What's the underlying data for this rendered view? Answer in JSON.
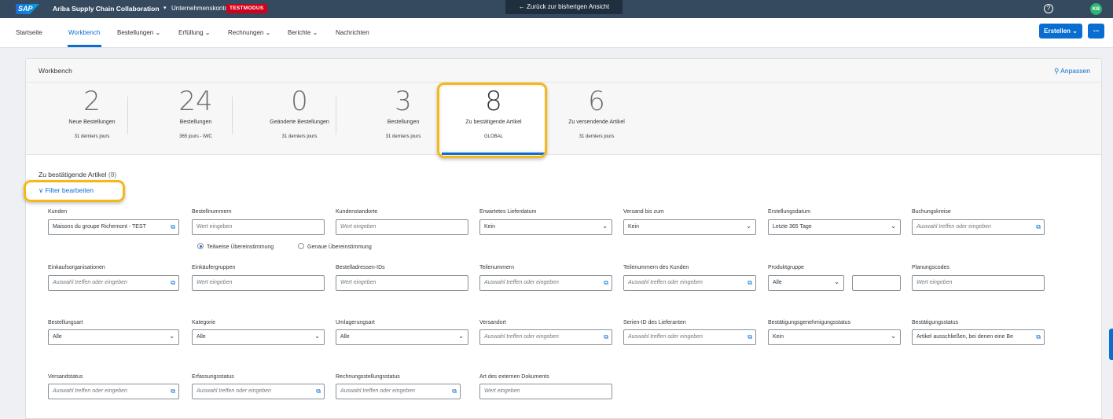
{
  "topbar": {
    "logo": "SAP",
    "app_title": "Ariba Supply Chain Collaboration",
    "caret": "▾",
    "account": "Unternehmenskonto",
    "mode_badge": "TESTMODUS",
    "back_button": "← Zurück zur bisherigen Ansicht",
    "help_icon": "?",
    "user_initials": "KB"
  },
  "nav": {
    "items": [
      {
        "label": "Startseite"
      },
      {
        "label": "Workbench"
      },
      {
        "label": "Bestellungen ⌄"
      },
      {
        "label": "Erfüllung ⌄"
      },
      {
        "label": "Rechnungen ⌄"
      },
      {
        "label": "Berichte ⌄"
      },
      {
        "label": "Nachrichten"
      }
    ],
    "active": "Workbench",
    "create_button": "Erstellen ⌄",
    "more_button": "..."
  },
  "workbench": {
    "title": "Workbench",
    "customize": "⚲ Anpassen",
    "tiles": [
      {
        "number": "2",
        "label": "Neue Bestellungen",
        "sub": "31 derniers jours"
      },
      {
        "number": "24",
        "label": "Bestellungen",
        "sub": "365 jours - IWC"
      },
      {
        "number": "0",
        "label": "Geänderte Bestellungen",
        "sub": "31 derniers jours"
      },
      {
        "number": "3",
        "label": "Bestellungen",
        "sub": "31 derniers jours"
      },
      {
        "number": "8",
        "label": "Zu bestätigende Artikel",
        "sub": "GLOBAL"
      },
      {
        "number": "6",
        "label": "Zu versendende Artikel",
        "sub": "31 derniers jours"
      }
    ],
    "selected_tile": "Zu bestätigende Artikel"
  },
  "section": {
    "title": "Zu bestätigende Artikel",
    "count": "(8)",
    "filter_link": "Filter bearbeiten",
    "filter_caret": "∨"
  },
  "filters": {
    "kunden": {
      "label": "Kunden",
      "value": "Maisons du groupe Richemont - TEST"
    },
    "bestellnummern": {
      "label": "Bestellnummern",
      "placeholder": "Wert eingeben"
    },
    "kundenstandorte": {
      "label": "Kundenstandorte",
      "placeholder": "Wert eingeben"
    },
    "lieferdatum": {
      "label": "Erwartetes Lieferdatum",
      "value": "Kein"
    },
    "versand_bis": {
      "label": "Versand bis zum",
      "value": "Kein"
    },
    "erstellungsdatum": {
      "label": "Erstellungsdatum",
      "value": "Letzte 365 Tage"
    },
    "buchungskreise": {
      "label": "Buchungskreise",
      "placeholder": "Auswahl treffen oder eingeben"
    },
    "match_partial": "Teilweise Übereinstimmung",
    "match_exact": "Genaue Übereinstimmung",
    "einkaufsorganisationen": {
      "label": "Einkaufsorganisationen",
      "placeholder": "Auswahl treffen oder eingeben"
    },
    "einkaeufergruppen": {
      "label": "Einkäufergruppen",
      "placeholder": "Wert eingeben"
    },
    "bestelladressen": {
      "label": "Bestelladressen-IDs",
      "placeholder": "Wert eingeben"
    },
    "teilenummern": {
      "label": "Teilenummern",
      "placeholder": "Auswahl treffen oder eingeben"
    },
    "teilenummern_kunden": {
      "label": "Teilenummern des Kunden",
      "placeholder": "Auswahl treffen oder eingeben"
    },
    "produktgruppe": {
      "label": "Produktgruppe",
      "value": "Alle"
    },
    "planungscodes": {
      "label": "Planungscodes",
      "placeholder": "Wert eingeben"
    },
    "bestellungsart": {
      "label": "Bestellungsart",
      "value": "Alle"
    },
    "kategorie": {
      "label": "Kategorie",
      "value": "Alle"
    },
    "umlagerungsart": {
      "label": "Umlagerungsart",
      "value": "Alle"
    },
    "versandort": {
      "label": "Versandort",
      "placeholder": "Auswahl treffen oder eingeben"
    },
    "serien_id": {
      "label": "Serien-ID des Lieferanten",
      "placeholder": "Auswahl treffen oder eingeben"
    },
    "genehmigungsstatus": {
      "label": "Bestätigungsgenehmigungsstatus",
      "value": "Kein"
    },
    "bestaetigungsstatus": {
      "label": "Bestätigungsstatus",
      "value": "Artikel ausschließen, bei denen eine Be"
    },
    "versandstatus": {
      "label": "Versandstatus",
      "placeholder": "Auswahl treffen oder eingeben"
    },
    "erfassungsstatus": {
      "label": "Erfassungsstatus",
      "placeholder": "Auswahl treffen oder eingeben"
    },
    "rechnungsstatus": {
      "label": "Rechnungsstellungsstatus",
      "placeholder": "Auswahl treffen oder eingeben"
    },
    "externes_dokument": {
      "label": "Art des externen Dokuments",
      "placeholder": "Wert eingeben"
    }
  },
  "colors": {
    "accent": "#0a6ed1",
    "shell": "#354a5f",
    "highlight": "#f6b818",
    "badge": "#d0021b"
  }
}
